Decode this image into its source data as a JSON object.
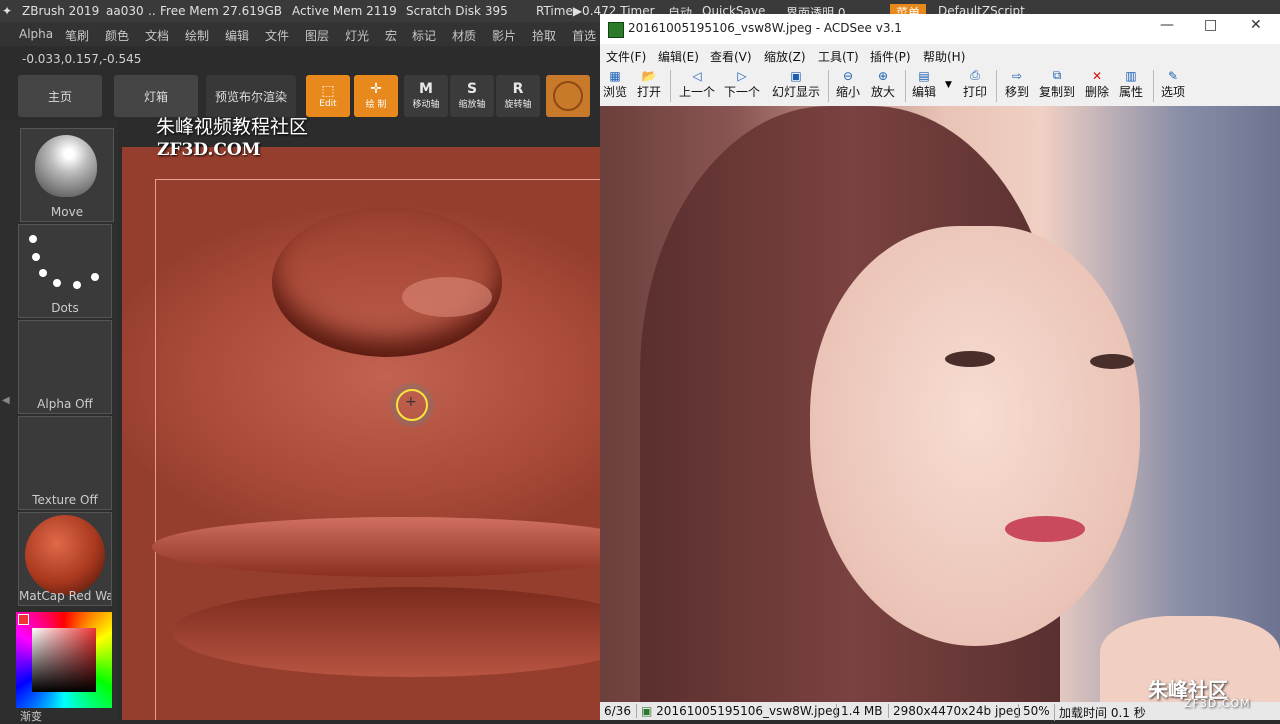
{
  "zbrush": {
    "title_items": [
      "ZBrush 2019",
      "aa030",
      "..",
      "Free Mem 27.619GB",
      "Active Mem 2119",
      "Scratch Disk 395",
      "RTime▶0.472 Timer",
      "自动",
      "QuickSave",
      "界面透明 0",
      "菜单",
      "DefaultZScript"
    ],
    "menu": [
      "Alpha",
      "笔刷",
      "颜色",
      "文档",
      "绘制",
      "编辑",
      "文件",
      "图层",
      "灯光",
      "宏",
      "标记",
      "材质",
      "影片",
      "拾取",
      "首选"
    ],
    "coords": "-0.033,0.157,-0.545",
    "buttons": {
      "home": "主页",
      "lightbox": "灯箱",
      "preview_bpr": "预览布尔渲染"
    },
    "tools": {
      "edit": "Edit",
      "draw": "绘 制",
      "move": "移动轴",
      "scale": "缩放轴",
      "rotate": "旋转轴"
    },
    "tool_glyphs": {
      "move": "M",
      "scale": "S",
      "rotate": "R"
    },
    "left_slots": {
      "brush": "Move",
      "stroke": "Dots",
      "alpha": "Alpha Off",
      "texture": "Texture Off",
      "material": "MatCap Red Wax"
    },
    "bottom_label": "渐变",
    "watermark": {
      "cn": "朱峰视频教程社区",
      "en": "ZF3D.COM"
    }
  },
  "acdsee": {
    "title": "20161005195106_vsw8W.jpeg - ACDSee v3.1",
    "menu": [
      "文件(F)",
      "编辑(E)",
      "查看(V)",
      "缩放(Z)",
      "工具(T)",
      "插件(P)",
      "帮助(H)"
    ],
    "toolbar": [
      "浏览",
      "打开",
      "上一个",
      "下一个",
      "幻灯显示",
      "缩小",
      "放大",
      "编辑",
      "打印",
      "移到",
      "复制到",
      "删除",
      "属性",
      "选项"
    ],
    "status": [
      "6/36",
      "20161005195106_vsw8W.jpeg",
      "1.4 MB",
      "2980x4470x24b jpeg",
      "50%",
      "加载时间 0.1 秒"
    ],
    "logo_cn": "朱峰社区",
    "logo_en": "ZF3D.COM"
  },
  "colors": {
    "zbrush_accent": "#e8891d",
    "acdsee_icon": "#1a5fb4"
  }
}
